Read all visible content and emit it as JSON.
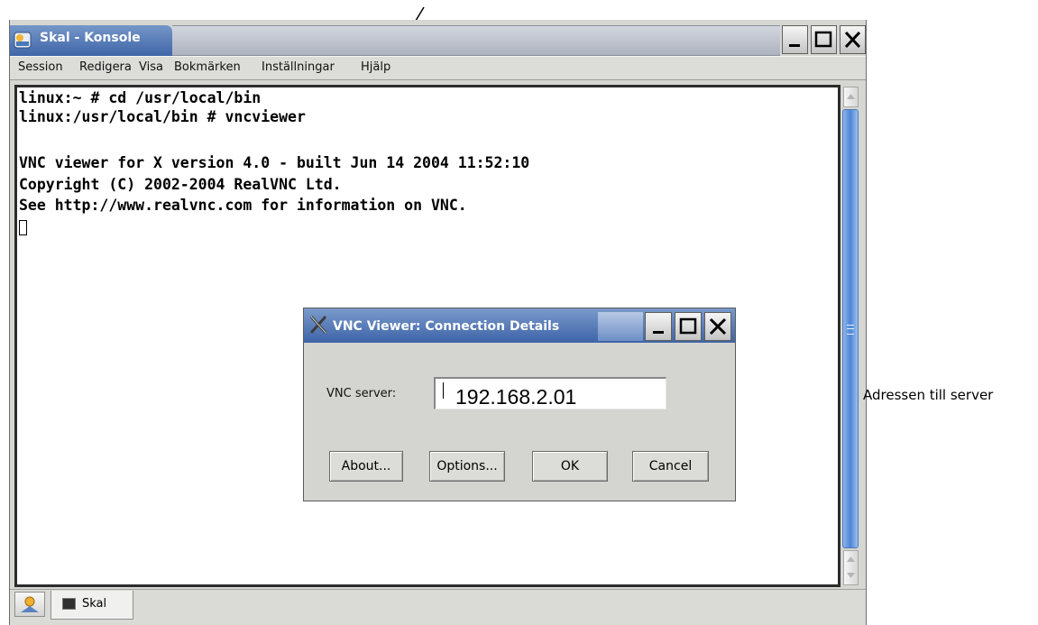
{
  "window": {
    "title": "Skal - Konsole",
    "buttons": {
      "minimize": "_",
      "maximize": "□",
      "close": "X"
    }
  },
  "menu": {
    "items": [
      "Session",
      "Redigera",
      "Visa",
      "Bokmärken",
      "Inställningar",
      "Hjälp"
    ]
  },
  "terminal": {
    "lines": [
      "linux:~ # cd /usr/local/bin",
      "linux:/usr/local/bin # vncviewer",
      "",
      "VNC viewer for X version 4.0 - built Jun 14 2004 11:52:10",
      "Copyright (C) 2002-2004 RealVNC Ltd.",
      "See http://www.realvnc.com for information on VNC."
    ]
  },
  "taskbar": {
    "tab_label": "Skal"
  },
  "dialog": {
    "title": "VNC Viewer: Connection Details",
    "server_label": "VNC server:",
    "server_value": "192.168.2.01",
    "buttons": {
      "about": "About...",
      "options": "Options...",
      "ok": "OK",
      "cancel": "Cancel"
    }
  },
  "annotation": {
    "label": "Adressen till server"
  },
  "colors": {
    "title_blue": "#3f66a8",
    "scroll_blue": "#4d85d7",
    "window_gray": "#d6d6d2"
  }
}
